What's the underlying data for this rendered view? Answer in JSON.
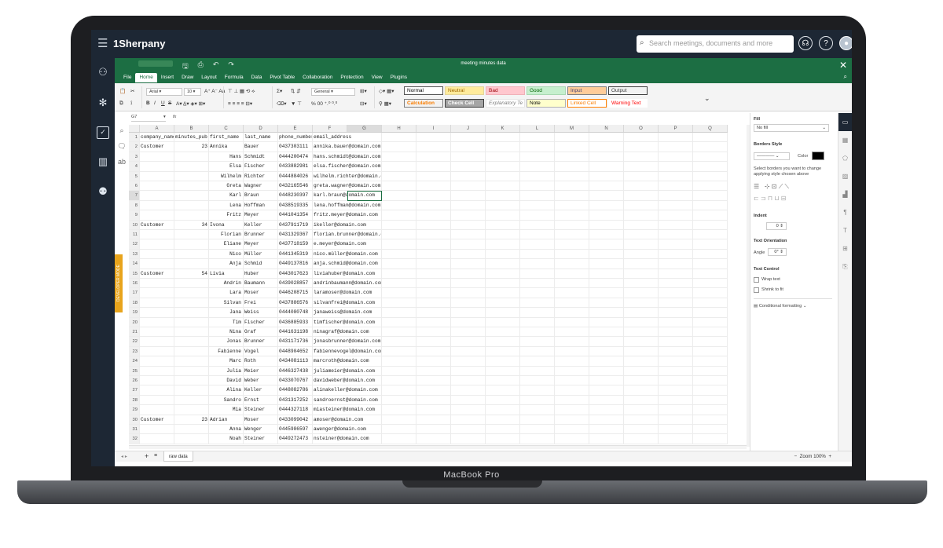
{
  "app": {
    "name": "1Sherpany",
    "search_placeholder": "Search meetings, documents and more",
    "device_brand": "MacBook Pro"
  },
  "nav": {
    "icons": [
      "org-chart-icon",
      "settings-icon",
      "tasks-icon",
      "buildings-icon",
      "users-icon"
    ]
  },
  "spreadsheet": {
    "title": "meeting minutes data",
    "menu": [
      "File",
      "Home",
      "Insert",
      "Draw",
      "Layout",
      "Formula",
      "Data",
      "Pivot Table",
      "Collaboration",
      "Protection",
      "View",
      "Plugins"
    ],
    "active_menu": "Home",
    "font": "Arial",
    "font_size": "10",
    "number_format": "General",
    "styles": [
      {
        "label": "Normal",
        "bg": "#ffffff",
        "fg": "#000000",
        "border": "#555555"
      },
      {
        "label": "Neutral",
        "bg": "#ffeb9c",
        "fg": "#9c6500",
        "border": "#e3d59a"
      },
      {
        "label": "Bad",
        "bg": "#ffc7ce",
        "fg": "#9c0006",
        "border": "#f0b0b8"
      },
      {
        "label": "Good",
        "bg": "#c6efce",
        "fg": "#006100",
        "border": "#a8d8b2"
      },
      {
        "label": "Input",
        "bg": "#ffcc99",
        "fg": "#3f3f76",
        "border": "#7f7f7f"
      },
      {
        "label": "Output",
        "bg": "#f2f2f2",
        "fg": "#3f3f3f",
        "border": "#3f3f3f"
      },
      {
        "label": "Calculation",
        "bg": "#f2f2f2",
        "fg": "#fa7d00",
        "border": "#7f7f7f"
      },
      {
        "label": "Check Cell",
        "bg": "#a5a5a5",
        "fg": "#ffffff",
        "border": "#3f3f3f"
      },
      {
        "label": "Explanatory Te",
        "bg": "#ffffff",
        "fg": "#7f7f7f",
        "border": "#e6e6e6"
      },
      {
        "label": "Note",
        "bg": "#ffffcc",
        "fg": "#000000",
        "border": "#b2b2b2"
      },
      {
        "label": "Linked Cell",
        "bg": "#ffffff",
        "fg": "#fa7d00",
        "border": "#ff8001"
      },
      {
        "label": "Warning Text",
        "bg": "#ffffff",
        "fg": "#ff0000",
        "border": "#ffffff"
      }
    ],
    "name_box": "G7",
    "fx": "fx",
    "columns": [
      "A",
      "B",
      "C",
      "D",
      "E",
      "F",
      "G",
      "H",
      "I",
      "J",
      "K",
      "L",
      "M",
      "N",
      "O",
      "P",
      "Q"
    ],
    "selected_column": "G",
    "selected_row": "7",
    "rows": [
      {
        "n": "1",
        "a": "company_name",
        "b": "minutes_pub",
        "c": "first_name",
        "d": "last_name",
        "e": "phone_number",
        "f": "email_address"
      },
      {
        "n": "2",
        "a": "Customer",
        "b": "23",
        "c": "Annika",
        "d": "Bauer",
        "e": "0437303111",
        "f": "annika.bauer@domain.com"
      },
      {
        "n": "3",
        "a": "",
        "b": "",
        "c": "Hans",
        "d": "Schmidt",
        "e": "0444200474",
        "f": "hans.schmidt@domain.com"
      },
      {
        "n": "4",
        "a": "",
        "b": "",
        "c": "Elsa",
        "d": "Fischer",
        "e": "0433882981",
        "f": "elsa.fischer@domain.com"
      },
      {
        "n": "5",
        "a": "",
        "b": "",
        "c": "Wilhelm",
        "d": "Richter",
        "e": "0444884026",
        "f": "wilhelm.richter@domain.com"
      },
      {
        "n": "6",
        "a": "",
        "b": "",
        "c": "Greta",
        "d": "Wagner",
        "e": "0432165546",
        "f": "greta.wagner@domain.com"
      },
      {
        "n": "7",
        "a": "",
        "b": "",
        "c": "Karl",
        "d": "Braun",
        "e": "0448230397",
        "f": "karl.braun@domain.com"
      },
      {
        "n": "8",
        "a": "",
        "b": "",
        "c": "Lena",
        "d": "Hoffman",
        "e": "0438519335",
        "f": "lena.hoffman@domain.com"
      },
      {
        "n": "9",
        "a": "",
        "b": "",
        "c": "Fritz",
        "d": "Meyer",
        "e": "0441041354",
        "f": "fritz.meyer@domain.com"
      },
      {
        "n": "10",
        "a": "Customer",
        "b": "34",
        "c": "Ivona",
        "d": "Keller",
        "e": "0437911719",
        "f": "ikeller@domain.com"
      },
      {
        "n": "11",
        "a": "",
        "b": "",
        "c": "Florian",
        "d": "Brunner",
        "e": "0431329367",
        "f": "florian.brunner@domain.com"
      },
      {
        "n": "12",
        "a": "",
        "b": "",
        "c": "Eliane",
        "d": "Meyer",
        "e": "0437718159",
        "f": "e.meyer@domain.com"
      },
      {
        "n": "13",
        "a": "",
        "b": "",
        "c": "Nico",
        "d": "Müller",
        "e": "0441345319",
        "f": "nico.müller@domain.com"
      },
      {
        "n": "14",
        "a": "",
        "b": "",
        "c": "Anja",
        "d": "Schmid",
        "e": "0449137816",
        "f": "anja.schmid@domain.com"
      },
      {
        "n": "15",
        "a": "Customer",
        "b": "54",
        "c": "Livia",
        "d": "Huber",
        "e": "0443017623",
        "f": "liviahuber@domain.com"
      },
      {
        "n": "16",
        "a": "",
        "b": "",
        "c": "Andrin",
        "d": "Baumann",
        "e": "0439028857",
        "f": "andrinbaumann@domain.com"
      },
      {
        "n": "17",
        "a": "",
        "b": "",
        "c": "Lara",
        "d": "Moser",
        "e": "0446208715",
        "f": "laramoser@domain.com"
      },
      {
        "n": "18",
        "a": "",
        "b": "",
        "c": "Silvan",
        "d": "Frei",
        "e": "0437886576",
        "f": "silvanfrei@domain.com"
      },
      {
        "n": "19",
        "a": "",
        "b": "",
        "c": "Jana",
        "d": "Weiss",
        "e": "0444080748",
        "f": "janaweiss@domain.com"
      },
      {
        "n": "20",
        "a": "",
        "b": "",
        "c": "Tim",
        "d": "Fischer",
        "e": "0436885933",
        "f": "timfischer@domain.com"
      },
      {
        "n": "21",
        "a": "",
        "b": "",
        "c": "Nina",
        "d": "Graf",
        "e": "0441631198",
        "f": "ninagraf@domain.com"
      },
      {
        "n": "22",
        "a": "",
        "b": "",
        "c": "Jonas",
        "d": "Brunner",
        "e": "0431171736",
        "f": "jonasbrunner@domain.com"
      },
      {
        "n": "23",
        "a": "",
        "b": "",
        "c": "Fabienne",
        "d": "Vogel",
        "e": "0448904652",
        "f": "fabiennevogel@domain.com"
      },
      {
        "n": "24",
        "a": "",
        "b": "",
        "c": "Marc",
        "d": "Roth",
        "e": "0434081113",
        "f": "marcroth@domain.com"
      },
      {
        "n": "25",
        "a": "",
        "b": "",
        "c": "Julia",
        "d": "Meier",
        "e": "0446327438",
        "f": "juliameier@domain.com"
      },
      {
        "n": "26",
        "a": "",
        "b": "",
        "c": "David",
        "d": "Weber",
        "e": "0433070767",
        "f": "davidweber@domain.com"
      },
      {
        "n": "27",
        "a": "",
        "b": "",
        "c": "Alina",
        "d": "Keller",
        "e": "0448082786",
        "f": "alinakeller@domain.com"
      },
      {
        "n": "28",
        "a": "",
        "b": "",
        "c": "Sandro",
        "d": "Ernst",
        "e": "0431317252",
        "f": "sandroernst@domain.com"
      },
      {
        "n": "29",
        "a": "",
        "b": "",
        "c": "Mia",
        "d": "Steiner",
        "e": "0444327118",
        "f": "miasteiner@domain.com"
      },
      {
        "n": "30",
        "a": "Customer",
        "b": "23",
        "c": "Adrian",
        "d": "Moser",
        "e": "0433099042",
        "f": "amoser@domain.com"
      },
      {
        "n": "31",
        "a": "",
        "b": "",
        "c": "Anna",
        "d": "Wenger",
        "e": "0445986597",
        "f": "awenger@domain.com"
      },
      {
        "n": "32",
        "a": "",
        "b": "",
        "c": "Noah",
        "d": "Steiner",
        "e": "0449272473",
        "f": "nsteiner@domain.com"
      }
    ],
    "developer_mode": "DEVELOPER MODE",
    "sheet_tab": "raw data",
    "zoom": "Zoom 100%"
  },
  "panel": {
    "fill_label": "Fill",
    "fill_value": "No fill",
    "borders_label": "Borders Style",
    "color_label": "Color",
    "border_color": "#000000",
    "borders_hint": "Select borders you want to change applying style chosen above",
    "indent_label": "Indent",
    "indent_value": "0",
    "orientation_label": "Text Orientation",
    "angle_label": "Angle",
    "angle_value": "0°",
    "control_label": "Text Control",
    "wrap_label": "Wrap text",
    "shrink_label": "Shrink to fit",
    "conditional_label": "Conditional formatting"
  }
}
